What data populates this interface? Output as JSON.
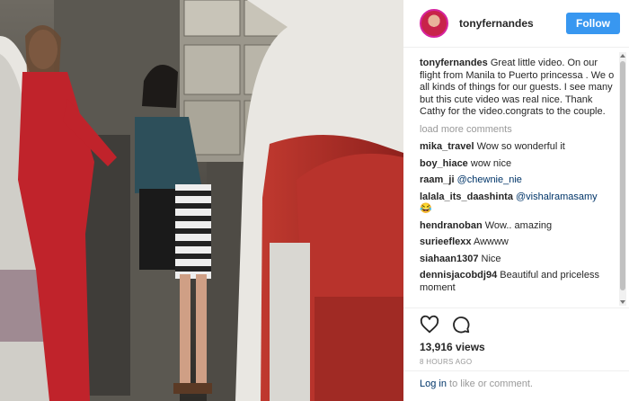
{
  "header": {
    "username": "tonyfernandes",
    "follow_label": "Follow"
  },
  "caption": {
    "username": "tonyfernandes",
    "text": "Great little video. On our flight from Manila to Puerto princessa . We o all kinds of things for our guests. I see many but this cute video was real nice. Thank Cathy for the video.congrats to the couple."
  },
  "load_more": "load more comments",
  "comments": [
    {
      "user": "mika_travel",
      "text": "Wow so wonderful it",
      "mention": ""
    },
    {
      "user": "boy_hiace",
      "text": "wow nice",
      "mention": ""
    },
    {
      "user": "raam_ji",
      "text": "",
      "mention": "@chewnie_nie"
    },
    {
      "user": "lalala_its_daashinta",
      "text": "",
      "mention": "@vishalramasamy",
      "emoji": "😂"
    },
    {
      "user": "hendranoban",
      "text": "Wow.. amazing",
      "mention": ""
    },
    {
      "user": "surieeflexx",
      "text": "Awwww",
      "mention": ""
    },
    {
      "user": "siahaan1307",
      "text": "Nice",
      "mention": ""
    },
    {
      "user": "dennisjacobdj94",
      "text": "Beautiful and priceless moment",
      "mention": ""
    }
  ],
  "actions": {
    "icons": [
      "heart-icon",
      "comment-icon"
    ],
    "views": "13,916 views",
    "time": "8 HOURS AGO"
  },
  "login": {
    "link": "Log in",
    "text": " to like or comment."
  },
  "colors": {
    "follow": "#3897f0",
    "mention": "#003569",
    "muted": "#999999",
    "seat_red": "#b8332c",
    "uniform_red": "#c0232b"
  }
}
